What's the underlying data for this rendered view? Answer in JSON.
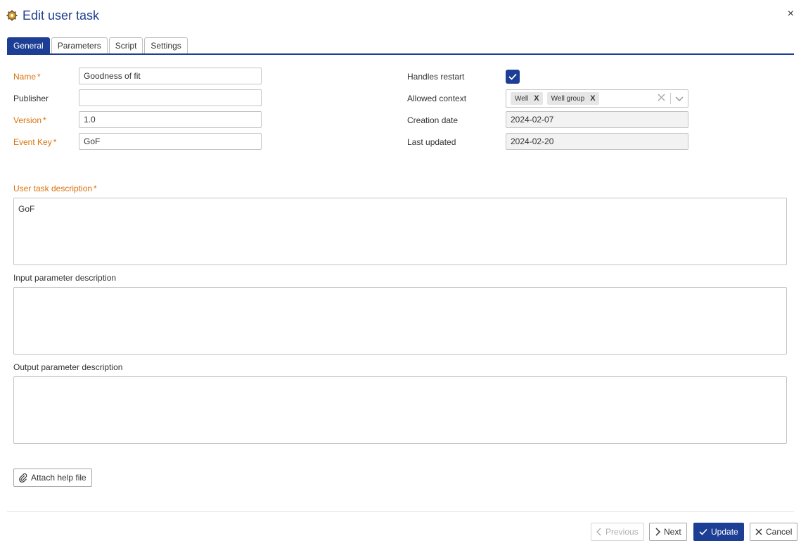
{
  "dialog": {
    "title": "Edit user task",
    "close": "×"
  },
  "tabs": [
    "General",
    "Parameters",
    "Script",
    "Settings"
  ],
  "form": {
    "name": {
      "label": "Name",
      "value": "Goodness of fit"
    },
    "publisher": {
      "label": "Publisher",
      "value": ""
    },
    "version": {
      "label": "Version",
      "value": "1.0"
    },
    "event_key": {
      "label": "Event Key",
      "value": "GoF"
    },
    "required_star": "*",
    "handles_restart": {
      "label": "Handles restart",
      "checked": true
    },
    "allowed_context": {
      "label": "Allowed context",
      "chips": [
        "Well",
        "Well group"
      ],
      "chip_remove": "X"
    },
    "creation_date": {
      "label": "Creation date",
      "value": "2024-02-07"
    },
    "last_updated": {
      "label": "Last updated",
      "value": "2024-02-20"
    },
    "user_task_description": {
      "label": "User task description",
      "value": "GoF"
    },
    "input_param_description": {
      "label": "Input parameter description",
      "value": ""
    },
    "output_param_description": {
      "label": "Output parameter description",
      "value": ""
    }
  },
  "attach_button": "Attach help file",
  "footer": {
    "previous": "Previous",
    "next": "Next",
    "update": "Update",
    "cancel": "Cancel"
  },
  "colors": {
    "accent": "#1c3e94",
    "required": "#d9730d"
  }
}
